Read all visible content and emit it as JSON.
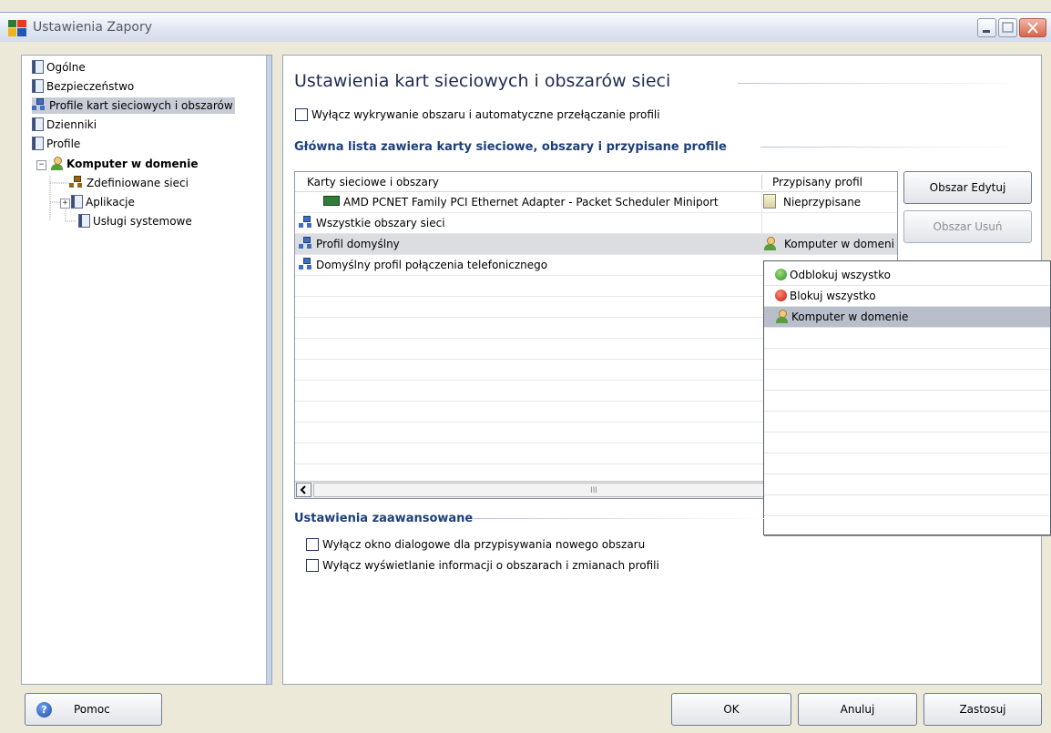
{
  "window": {
    "title": "Ustawienia Zapory"
  },
  "tree": {
    "items": [
      {
        "label": "Ogólne"
      },
      {
        "label": "Bezpieczeństwo"
      },
      {
        "label": "Profile kart sieciowych i obszarów"
      },
      {
        "label": "Dzienniki"
      },
      {
        "label": "Profile"
      },
      {
        "label": "Komputer w domenie"
      },
      {
        "label": "Zdefiniowane sieci"
      },
      {
        "label": "Aplikacje"
      },
      {
        "label": "Usługi systemowe"
      }
    ],
    "selected": "Profile kart sieciowych i obszarów"
  },
  "main": {
    "title": "Ustawienia kart sieciowych i obszarów sieci",
    "disable_detection_label": "Wyłącz wykrywanie obszaru i automatyczne przełączanie profili",
    "list_heading": "Główna lista zawiera karty sieciowe, obszary i przypisane profile",
    "columns": [
      "Karty sieciowe i obszary",
      "Przypisany profil"
    ],
    "rows": [
      {
        "name": "AMD PCNET Family PCI Ethernet Adapter - Packet Scheduler Miniport",
        "profile": "Nieprzypisane"
      },
      {
        "name": "Wszystkie obszary sieci",
        "profile": ""
      },
      {
        "name": "Profil domyślny",
        "profile": "Komputer w domeni"
      },
      {
        "name": "Domyślny profil połączenia telefonicznego",
        "profile": ""
      }
    ],
    "scroll_grip": "III",
    "edit_button": "Obszar Edytuj",
    "delete_button": "Obszar Usuń",
    "advanced_heading": "Ustawienia zaawansowane",
    "advanced_options": [
      {
        "label": "Wyłącz okno dialogowe dla przypisywania nowego obszaru",
        "checked": false
      },
      {
        "label": "Wyłącz wyświetlanie informacji o obszarach i zmianach profili",
        "checked": false
      }
    ]
  },
  "dropdown": {
    "options": [
      {
        "label": "Odblokuj wszystko",
        "icon": "green-up-arrow-icon"
      },
      {
        "label": "Blokuj wszystko",
        "icon": "red-block-icon"
      },
      {
        "label": "Komputer w domenie",
        "icon": "user-icon"
      }
    ],
    "highlighted": "Komputer w domenie"
  },
  "footer": {
    "help_label": "Pomoc",
    "ok_label": "OK",
    "cancel_label": "Anuluj",
    "apply_label": "Zastosuj"
  },
  "colors": {
    "accent": "#1d3f7a",
    "selection": "#b9bfca",
    "row_highlight": "#dcdde0"
  }
}
